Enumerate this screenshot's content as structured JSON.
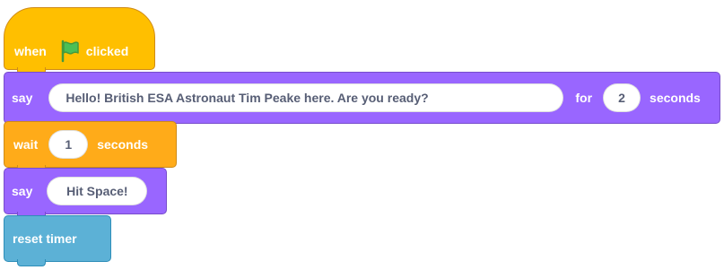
{
  "script": {
    "hat_block": {
      "when_label": "when",
      "icon": "green-flag-icon",
      "clicked_label": "clicked",
      "color": "#ffbf00"
    },
    "say_for_block": {
      "say_label": "say",
      "message": "Hello! British ESA Astronaut Tim Peake here. Are you ready?",
      "for_label": "for",
      "seconds_value": "2",
      "seconds_label": "seconds",
      "color": "#9966ff"
    },
    "wait_block": {
      "wait_label": "wait",
      "seconds_value": "1",
      "seconds_label": "seconds",
      "color": "#ffab19"
    },
    "say_block": {
      "say_label": "say",
      "message": "Hit Space!",
      "color": "#9966ff"
    },
    "reset_timer_block": {
      "label": "reset timer",
      "color": "#5cb1d6"
    }
  }
}
